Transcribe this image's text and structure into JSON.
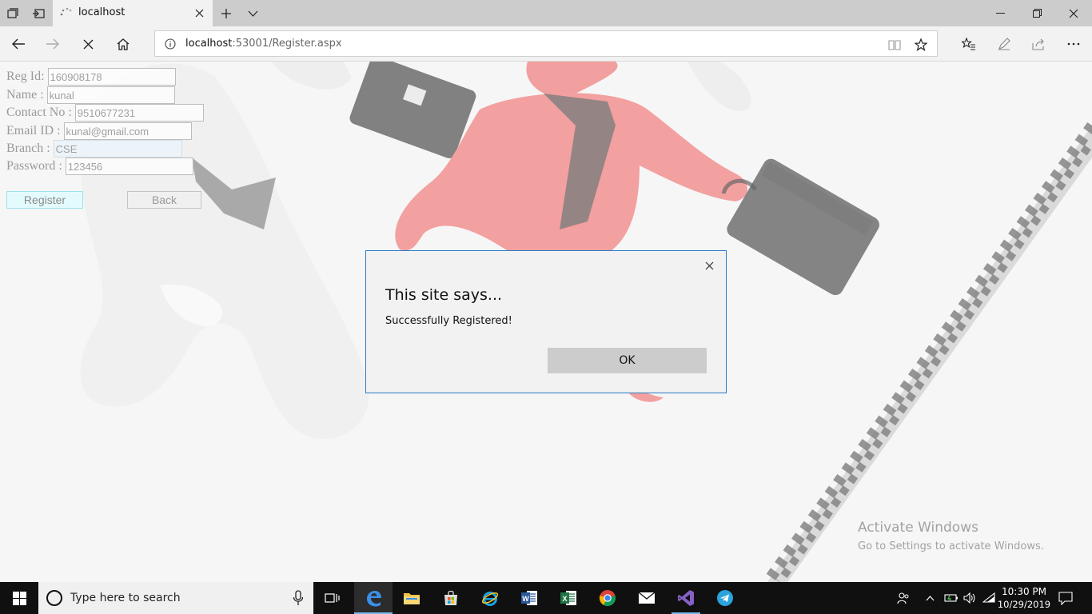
{
  "browser": {
    "tab_title": "localhost",
    "url_host": "localhost",
    "url_rest": ":53001/Register.aspx"
  },
  "form": {
    "reg_id_label": "Reg Id:",
    "reg_id_value": "160908178",
    "name_label": "Name :",
    "name_value": "kunal",
    "contact_label": "Contact No :",
    "contact_value": "9510677231",
    "email_label": "Email ID :",
    "email_value": "kunal@gmail.com",
    "branch_label": "Branch :",
    "branch_value": "CSE",
    "password_label": "Password :",
    "password_value": "123456",
    "register_label": "Register",
    "back_label": "Back"
  },
  "dialog": {
    "title": "This site says...",
    "message": "Successfully Registered!",
    "ok_label": "OK"
  },
  "watermark": {
    "line1": "Activate Windows",
    "line2": "Go to Settings to activate Windows."
  },
  "taskbar": {
    "search_placeholder": "Type here to search",
    "time": "10:30 PM",
    "date": "10/29/2019"
  },
  "colors": {
    "dialog_border": "#2a7cc4",
    "taskbar": "#101010",
    "active_indicator": "#76b9ed"
  }
}
